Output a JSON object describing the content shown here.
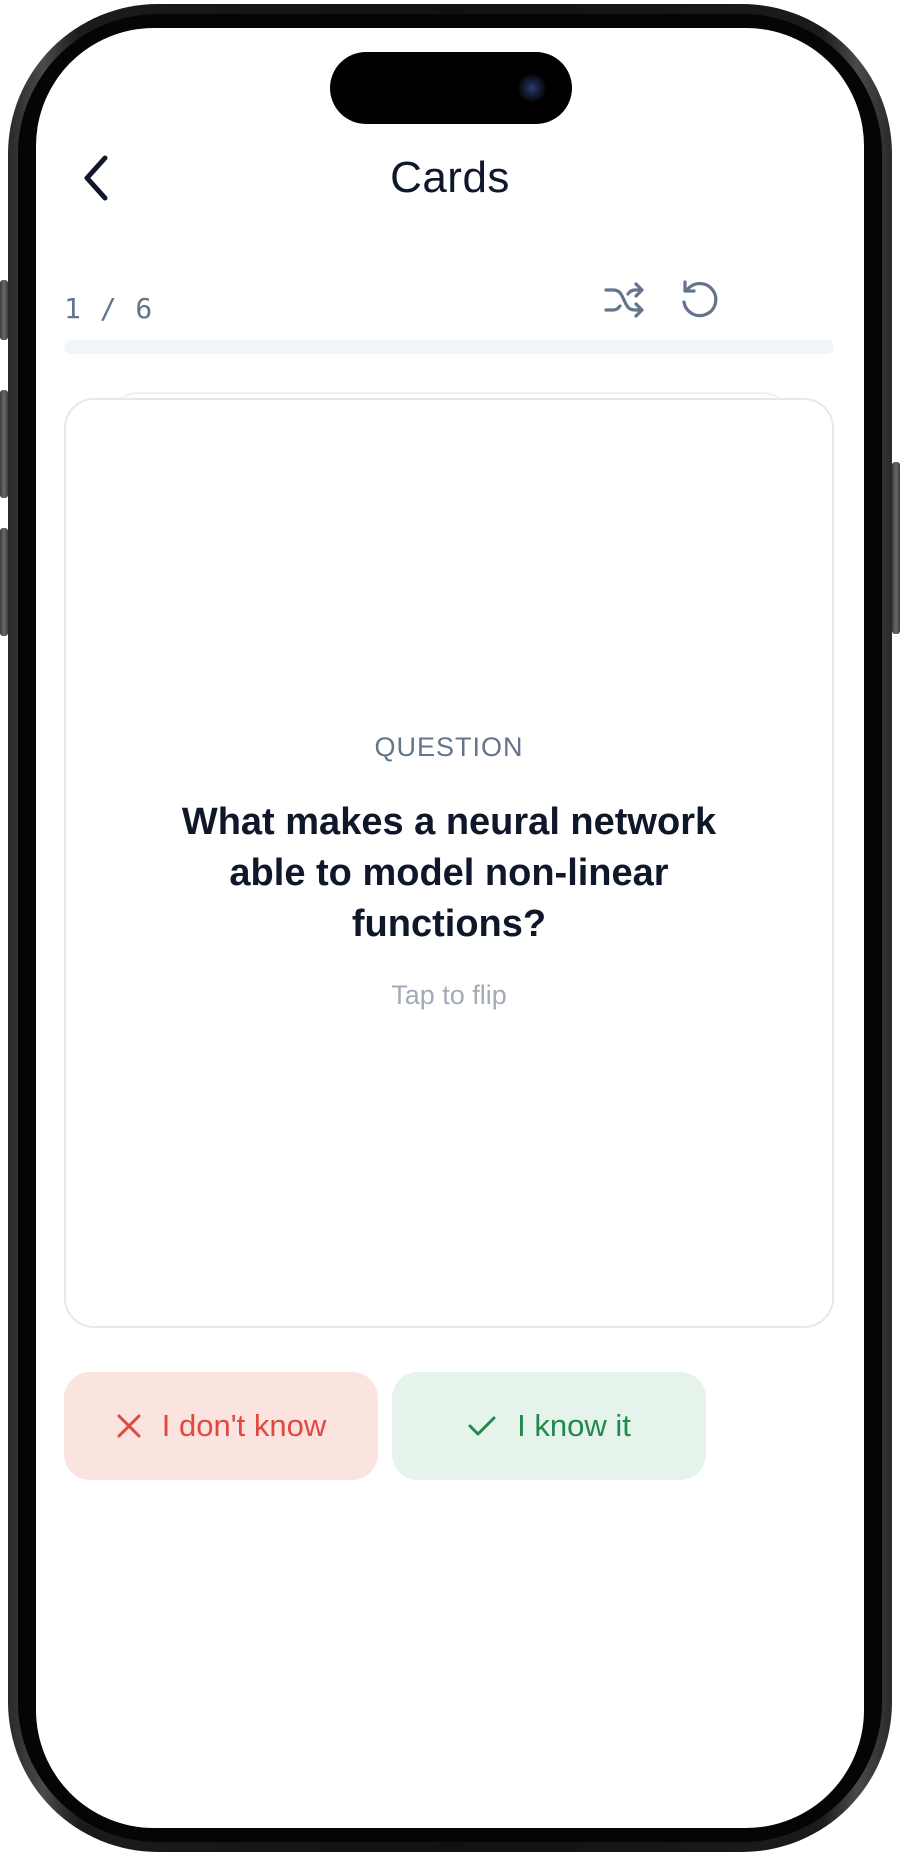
{
  "header": {
    "title": "Cards"
  },
  "progress": {
    "counter": "1 / 6",
    "fraction": 0.0
  },
  "card": {
    "label": "QUESTION",
    "question": "What makes a neural network able to model non-linear functions?",
    "hint": "Tap to flip"
  },
  "actions": {
    "dont_know_label": "I don't know",
    "know_label": "I know it"
  },
  "colors": {
    "dont_know_bg": "#fbe4df",
    "dont_know_fg": "#e1483f",
    "know_bg": "#e5f3ea",
    "know_fg": "#1f8a4c",
    "title": "#0f172a",
    "muted": "#64748b"
  },
  "icons": {
    "back": "chevron-left-icon",
    "shuffle": "shuffle-icon",
    "reset": "rotate-ccw-icon",
    "dont_know": "x-icon",
    "know": "check-icon"
  }
}
